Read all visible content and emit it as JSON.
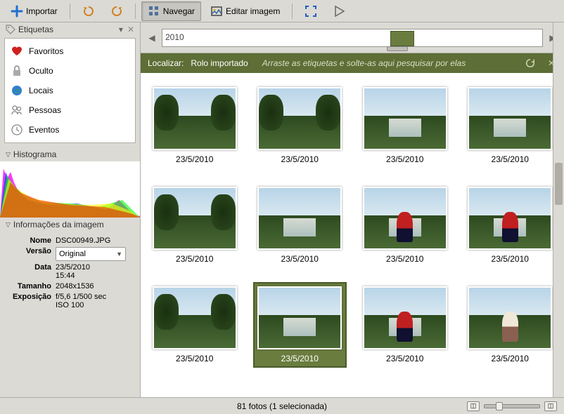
{
  "toolbar": {
    "import": "Importar",
    "browse": "Navegar",
    "edit": "Editar imagem"
  },
  "sidebar": {
    "tags_title": "Etiquetas",
    "items": [
      {
        "label": "Favoritos",
        "icon": "heart"
      },
      {
        "label": "Oculto",
        "icon": "lock"
      },
      {
        "label": "Locais",
        "icon": "globe"
      },
      {
        "label": "Pessoas",
        "icon": "people"
      },
      {
        "label": "Eventos",
        "icon": "clock"
      }
    ],
    "histogram_title": "Histograma",
    "info_title": "Informações da imagem",
    "info": {
      "name_label": "Nome",
      "name_value": "DSC00949.JPG",
      "version_label": "Versão",
      "version_value": "Original",
      "date_label": "Data",
      "date_value": "23/5/2010",
      "time_value": "15:44",
      "size_label": "Tamanho",
      "size_value": "2048x1536",
      "exposure_label": "Exposição",
      "exposure_value": "f/5,6 1/500 sec",
      "iso_value": "ISO 100"
    }
  },
  "timeline": {
    "year": "2010"
  },
  "searchbar": {
    "locate": "Localizar:",
    "roll": "Rolo importado",
    "hint": "Arraste as etiquetas e solte-as aqui pesquisar por elas"
  },
  "thumbnails": [
    {
      "date": "23/5/2010",
      "variant": "landscape"
    },
    {
      "date": "23/5/2010",
      "variant": "foliage"
    },
    {
      "date": "23/5/2010",
      "variant": "falls"
    },
    {
      "date": "23/5/2010",
      "variant": "wide"
    },
    {
      "date": "23/5/2010",
      "variant": "foliage"
    },
    {
      "date": "23/5/2010",
      "variant": "falls"
    },
    {
      "date": "23/5/2010",
      "variant": "person-red"
    },
    {
      "date": "23/5/2010",
      "variant": "person-red"
    },
    {
      "date": "23/5/2010",
      "variant": "foliage"
    },
    {
      "date": "23/5/2010",
      "variant": "falls",
      "selected": true
    },
    {
      "date": "23/5/2010",
      "variant": "person-red"
    },
    {
      "date": "23/5/2010",
      "variant": "person-white"
    }
  ],
  "statusbar": {
    "text": "81 fotos (1 selecionada)"
  }
}
